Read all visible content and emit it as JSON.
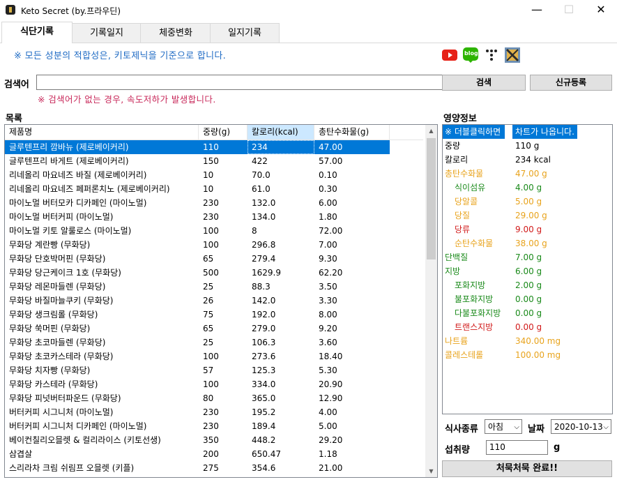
{
  "window": {
    "title": "Keto Secret (by.프라우딘)",
    "minimize": "—",
    "maximize": "☐",
    "close": "✕"
  },
  "tabs": [
    "식단기록",
    "기록일지",
    "체중변화",
    "일지기록"
  ],
  "notice": "※ 모든 성분의 적합성은, 키토제닉을 기준으로 합니다.",
  "social": {
    "youtube_icon": "youtube-icon",
    "blog_label": "blog",
    "dots_icon": "dots-icon",
    "profile_icon": "profile-image-icon"
  },
  "search": {
    "label": "검색어",
    "value": "",
    "button": "검색",
    "register_button": "신규등록",
    "warning": "※ 검색어가 없는 경우, 속도저하가 발생합니다."
  },
  "list": {
    "title": "목록",
    "columns": [
      "제품명",
      "중량(g)",
      "칼로리(kcal)",
      "총탄수화물(g)"
    ],
    "rows": [
      [
        "글루텐프리 깜바뉴 (제로베이커리)",
        "110",
        "234",
        "47.00"
      ],
      [
        "글루텐프리 바게트 (제로베이커리)",
        "150",
        "422",
        "57.00"
      ],
      [
        "리네올리 마요네즈 바질 (제로베이커리)",
        "10",
        "70.0",
        "0.10"
      ],
      [
        "리네올리 마요네즈 페퍼론치노 (제로베이커리)",
        "10",
        "61.0",
        "0.30"
      ],
      [
        "마이노멀 버터모카 디카페인 (마이노멀)",
        "230",
        "132.0",
        "6.00"
      ],
      [
        "마이노멀 버터커피 (마이노멀)",
        "230",
        "134.0",
        "1.80"
      ],
      [
        "마이노멀 키토 알룰로스 (마이노멀)",
        "100",
        "8",
        "72.00"
      ],
      [
        "무화당 계란빵 (무화당)",
        "100",
        "296.8",
        "7.00"
      ],
      [
        "무화당 단호박머핀 (무화당)",
        "65",
        "279.4",
        "9.30"
      ],
      [
        "무화당 당근케이크 1호 (무화당)",
        "500",
        "1629.9",
        "62.20"
      ],
      [
        "무화당 레몬마들렌 (무화당)",
        "25",
        "88.3",
        "3.50"
      ],
      [
        "무화당 바질마늘쿠키 (무화당)",
        "26",
        "142.0",
        "3.30"
      ],
      [
        "무화당 생크림롤 (무화당)",
        "75",
        "192.0",
        "8.00"
      ],
      [
        "무화당 쑥머핀 (무화당)",
        "65",
        "279.0",
        "9.20"
      ],
      [
        "무화당 초코마들렌 (무화당)",
        "25",
        "106.3",
        "3.60"
      ],
      [
        "무화당 초코카스테라 (무화당)",
        "100",
        "273.6",
        "18.40"
      ],
      [
        "무화당 치자빵 (무화당)",
        "57",
        "125.3",
        "5.30"
      ],
      [
        "무화당 카스테라 (무화당)",
        "100",
        "334.0",
        "20.90"
      ],
      [
        "무화당 피넛버터파운드 (무화당)",
        "80",
        "365.0",
        "12.90"
      ],
      [
        "버터커피 시그니처 (마이노멀)",
        "230",
        "195.2",
        "4.00"
      ],
      [
        "버터커피 시그니처 디카페인 (마이노멀)",
        "230",
        "189.4",
        "5.00"
      ],
      [
        "베이컨칠리오믈렛 & 컬리라이스 (키토선생)",
        "350",
        "448.2",
        "29.20"
      ],
      [
        "삼겹살",
        "200",
        "650.47",
        "1.18"
      ],
      [
        "스리라차 크림 쉬림프 오믈렛 (키플)",
        "275",
        "354.6",
        "21.00"
      ]
    ]
  },
  "nutrition": {
    "title": "영양정보",
    "header_key": "※ 더블클릭하면",
    "header_val": "차트가 나옵니다.",
    "rows": [
      {
        "k": "중량",
        "v": "110 g",
        "color": "#000000",
        "indent": 0
      },
      {
        "k": "칼로리",
        "v": "234 kcal",
        "color": "#000000",
        "indent": 0
      },
      {
        "k": "총탄수화물",
        "v": "47.00 g",
        "color": "#e8a31c",
        "indent": 0
      },
      {
        "k": "식이섬유",
        "v": "4.00 g",
        "color": "#1a8a1a",
        "indent": 1
      },
      {
        "k": "당알콜",
        "v": "5.00 g",
        "color": "#e8a31c",
        "indent": 1
      },
      {
        "k": "당질",
        "v": "29.00 g",
        "color": "#e8a31c",
        "indent": 1
      },
      {
        "k": "당류",
        "v": "9.00 g",
        "color": "#d11a1a",
        "indent": 1
      },
      {
        "k": "순탄수화물",
        "v": "38.00 g",
        "color": "#e8a31c",
        "indent": 1
      },
      {
        "k": "단백질",
        "v": "7.00 g",
        "color": "#1a8a1a",
        "indent": 0
      },
      {
        "k": "지방",
        "v": "6.00 g",
        "color": "#1a8a1a",
        "indent": 0
      },
      {
        "k": "포화지방",
        "v": "2.00 g",
        "color": "#1a8a1a",
        "indent": 1
      },
      {
        "k": "불포화지방",
        "v": "0.00 g",
        "color": "#1a8a1a",
        "indent": 1
      },
      {
        "k": "다불포화지방",
        "v": "0.00 g",
        "color": "#1a8a1a",
        "indent": 1
      },
      {
        "k": "트랜스지방",
        "v": "0.00 g",
        "color": "#d11a1a",
        "indent": 1
      },
      {
        "k": "나트륨",
        "v": "340.00 mg",
        "color": "#e8a31c",
        "indent": 0
      },
      {
        "k": "콜레스테롤",
        "v": "100.00 mg",
        "color": "#e8a31c",
        "indent": 0
      }
    ]
  },
  "entry": {
    "meal_label": "식사종류",
    "meal_value": "아침",
    "date_label": "날짜",
    "date_value": "2020-10-13",
    "amount_label": "섭취량",
    "amount_value": "110",
    "amount_unit": "g",
    "submit": "처묵처묵 완료!!"
  }
}
